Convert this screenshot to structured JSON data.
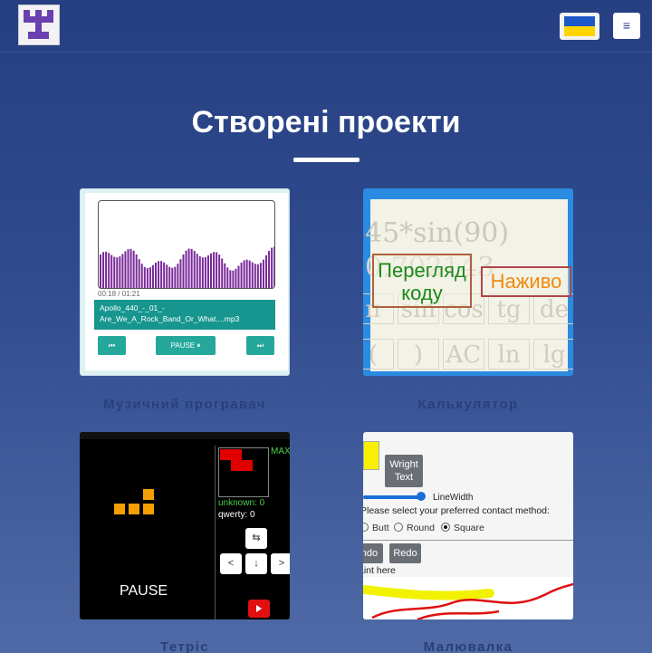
{
  "header": {
    "logo": "site-logo",
    "language": "Українська",
    "menu_icon": "≡"
  },
  "section": {
    "title": "Створені проекти"
  },
  "projects": [
    {
      "caption": "Музичний програвач",
      "time": "00:18 / 01:21",
      "track_line1": "Apollo_440_-_01_-",
      "track_line2": "Are_We_A_Rock_Band_Or_What....mp3",
      "prev_icon": "⏮",
      "pause_label": "PAUSE",
      "pause_icon": "⏸",
      "next_icon": "⏭"
    },
    {
      "caption": "Калькулятор",
      "expr": "45*sin(90)",
      "result": "0.702143",
      "keys": [
        "π",
        "sin",
        "cos",
        "tg",
        "de",
        "(",
        ")",
        "AC",
        "ln",
        "lg"
      ],
      "view_label": "Перегляд коду",
      "live_label": "Наживо"
    },
    {
      "caption": "Тетріс",
      "max_label": "MAX",
      "score1": "unknown: 0",
      "score2": "qwerty: 0",
      "pause": "PAUSE",
      "btn_rotate": "⇆",
      "btn_left": "<",
      "btn_down": "↓",
      "btn_right": ">"
    },
    {
      "caption": "Малювалка",
      "button_text": "Wright Text",
      "line_width": "LineWidth",
      "prompt": "Please select your preferred contact method:",
      "opt1": "Butt",
      "opt2": "Round",
      "opt3": "Square",
      "undo": "Undo",
      "redo": "Redo",
      "paint_text": "Paint here"
    }
  ]
}
